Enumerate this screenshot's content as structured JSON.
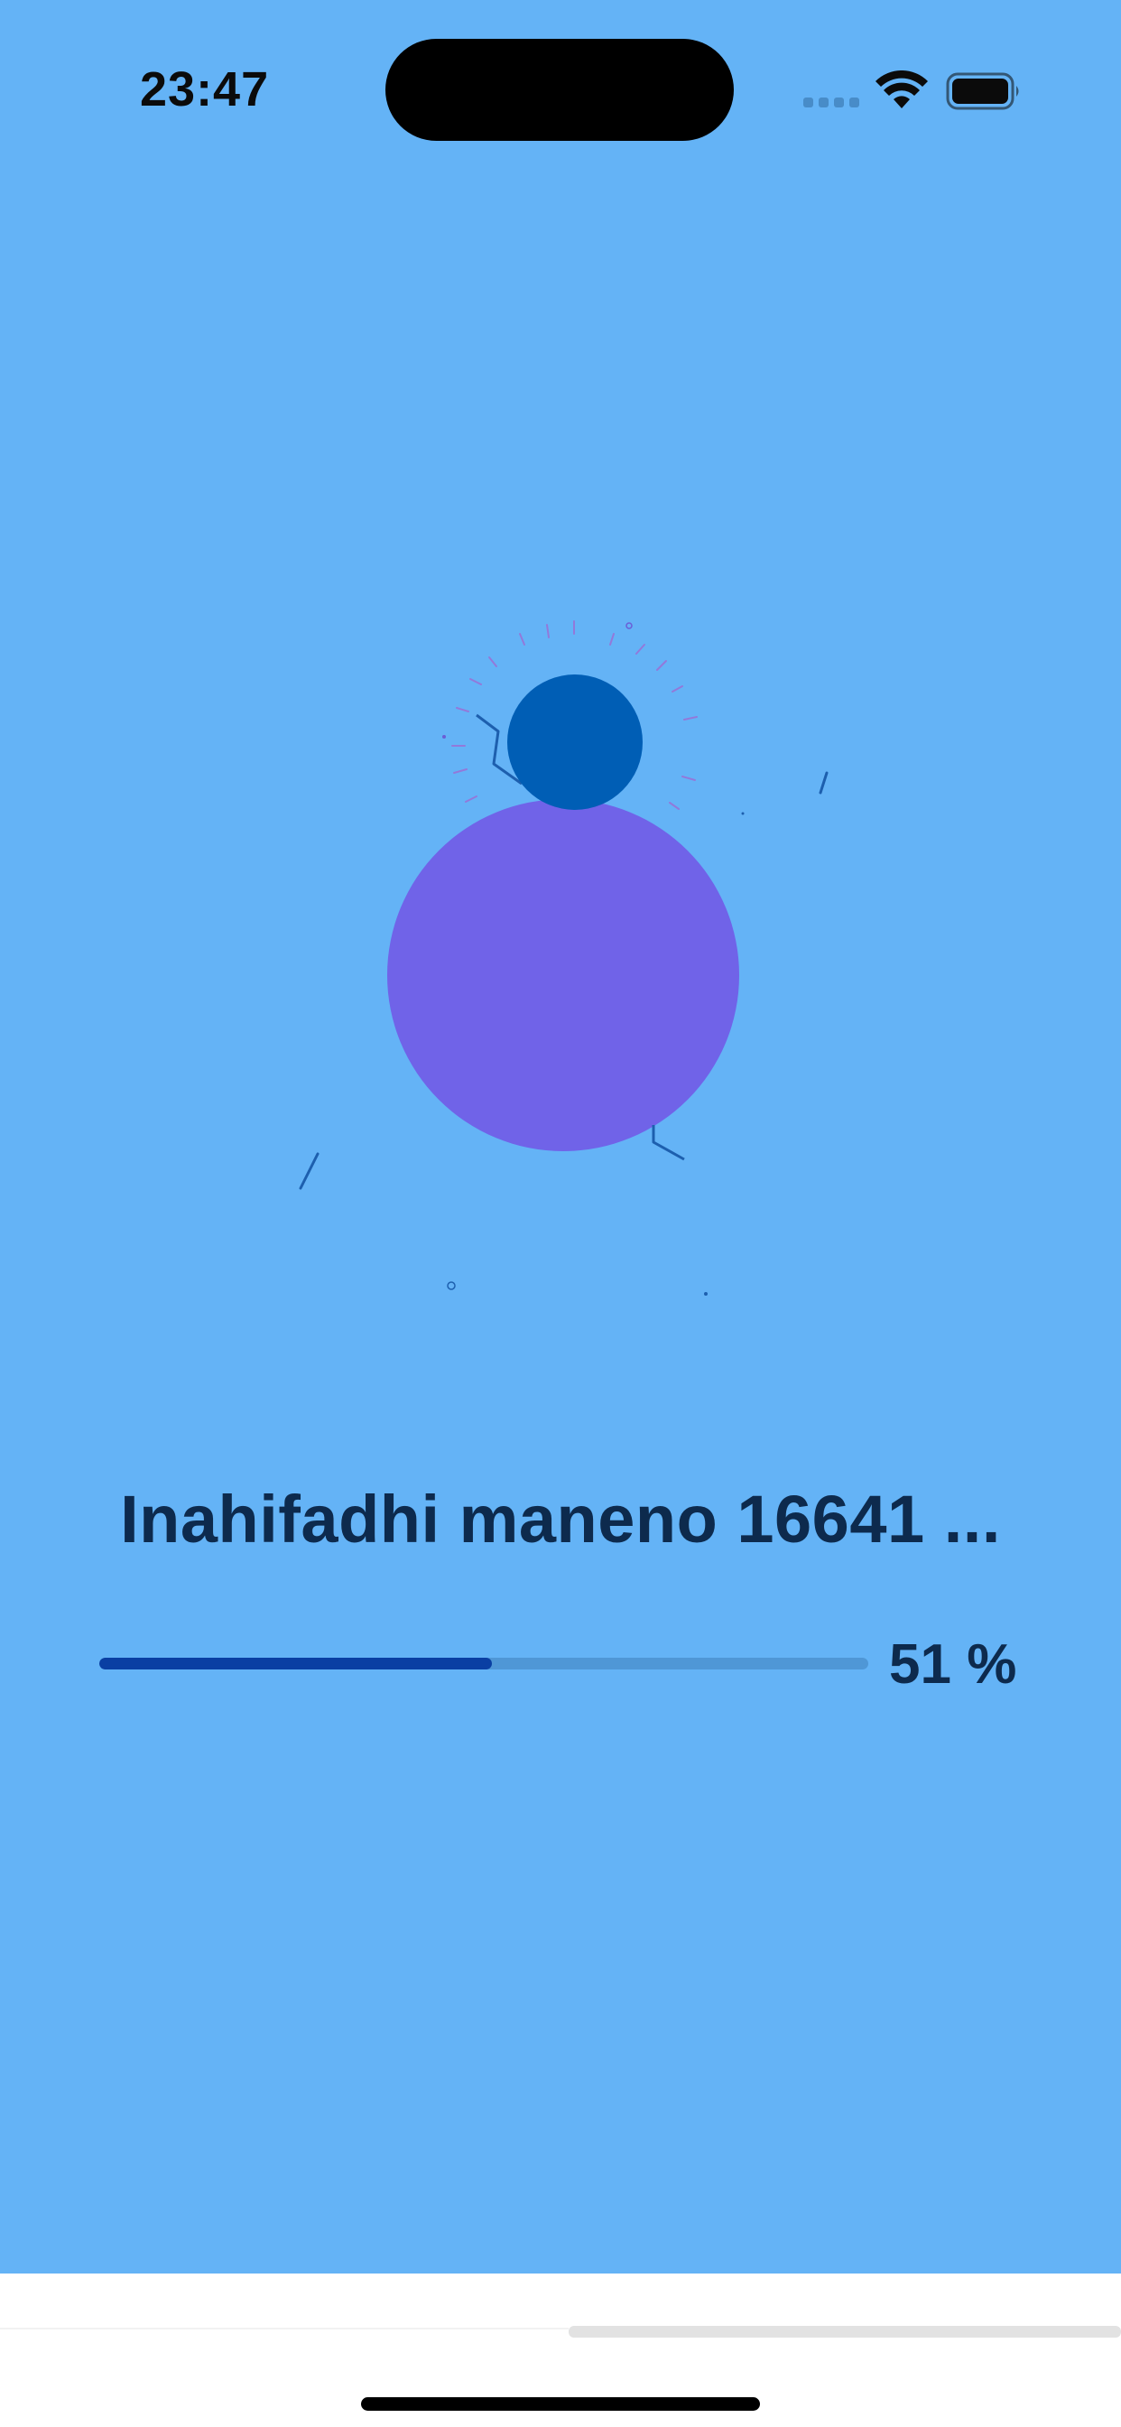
{
  "status_bar": {
    "time": "23:47",
    "icons": [
      "cellular-signal-icon",
      "wifi-icon",
      "battery-icon"
    ]
  },
  "illustration": {
    "icons": [
      "large-purple-circle",
      "small-blue-circle",
      "sparkle-ticks"
    ],
    "colors": {
      "background": "#64b3f6",
      "large_circle": "#7063e8",
      "small_circle": "#005eb5",
      "ticks": "#9b6fd6",
      "lines": "#1d5fae"
    }
  },
  "progress": {
    "message": "Inahifadhi maneno 16641 ...",
    "percent_label": "51 %",
    "value": 0.51
  },
  "colors": {
    "title_text": "#0d2a4d",
    "progress_fill": "#0a3fa3",
    "progress_track": "#4f97d6"
  }
}
